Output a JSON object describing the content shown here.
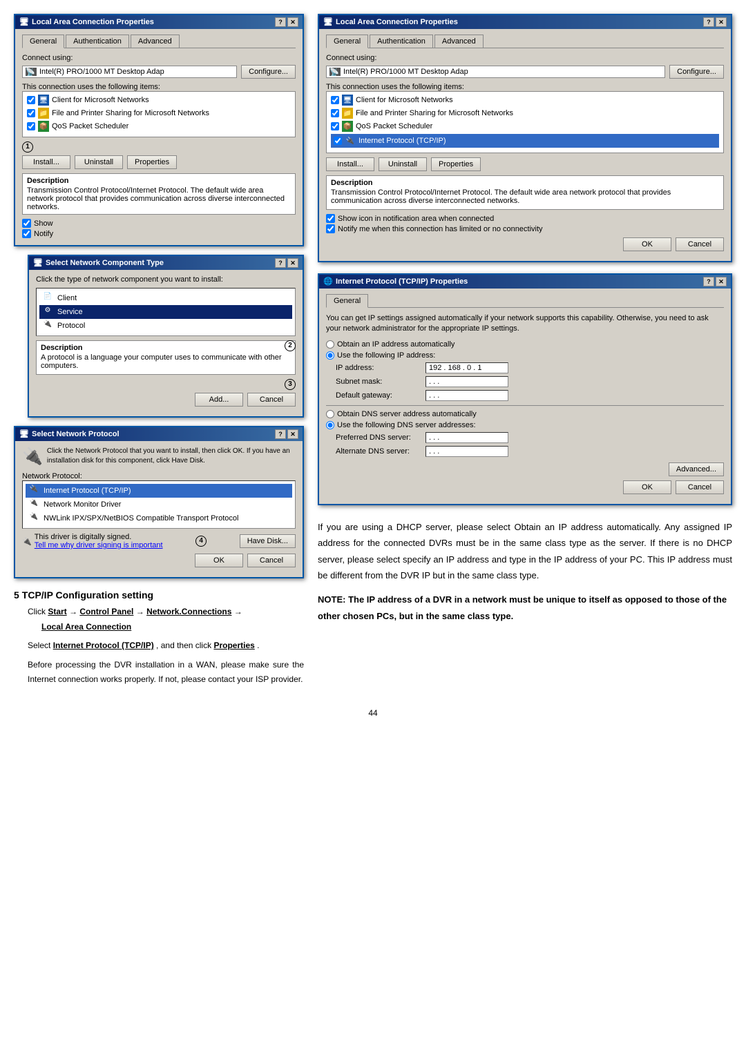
{
  "page": {
    "number": "44"
  },
  "dialog1": {
    "title": "Local Area Connection Properties",
    "tabs": [
      "General",
      "Authentication",
      "Advanced"
    ],
    "active_tab": "General",
    "connect_using_label": "Connect using:",
    "adapter_name": "Intel(R) PRO/1000 MT Desktop Adap",
    "configure_btn": "Configure...",
    "connection_items_label": "This connection uses the following items:",
    "items": [
      {
        "checked": true,
        "icon": "blue",
        "name": "Client for Microsoft Networks"
      },
      {
        "checked": true,
        "icon": "yellow",
        "name": "File and Printer Sharing for Microsoft Networks"
      },
      {
        "checked": true,
        "icon": "green",
        "name": "QoS Packet Scheduler"
      }
    ],
    "install_btn": "Install...",
    "uninstall_btn": "Uninstall",
    "properties_btn": "Properties",
    "desc_label": "Description",
    "desc_text": "Transmission Control Protocol/Internet Protocol. The default wide area network protocol that provides communication across diverse interconnected networks.",
    "show_icon_label": "Show",
    "notify_label": "Notify",
    "number_label": "1"
  },
  "dialog2": {
    "title": "Select Network Component Type",
    "instruction": "Click the type of network component you want to install:",
    "items": [
      {
        "icon": "📄",
        "name": "Client"
      },
      {
        "icon": "⚙",
        "name": "Service",
        "selected": true
      },
      {
        "icon": "🔌",
        "name": "Protocol"
      }
    ],
    "desc_label": "Description",
    "desc_text": "A protocol is a language your computer uses to communicate with other computers.",
    "add_btn": "Add...",
    "cancel_btn": "Cancel",
    "number_label": "2",
    "add_number": "3"
  },
  "dialog3": {
    "title": "Select Network Protocol",
    "instruction": "Click the Network Protocol that you want to install, then click OK. If you have an installation disk for this component, click Have Disk.",
    "network_protocol_label": "Network Protocol:",
    "protocols": [
      {
        "icon": "🔌",
        "name": "Internet Protocol (TCP/IP)",
        "selected": true
      },
      {
        "icon": "🔌",
        "name": "Network Monitor Driver"
      },
      {
        "icon": "🔌",
        "name": "NWLink IPX/SPX/NetBIOS Compatible Transport Protocol"
      }
    ],
    "driver_signed": "This driver is digitally signed.",
    "driver_link": "Tell me why driver signing is important",
    "have_disk_btn": "Have Disk...",
    "ok_btn": "OK",
    "cancel_btn": "Cancel",
    "number_label": "4"
  },
  "dialog4": {
    "title": "Local Area Connection Properties",
    "tabs": [
      "General",
      "Authentication",
      "Advanced"
    ],
    "active_tab": "General",
    "connect_using_label": "Connect using:",
    "adapter_name": "Intel(R) PRO/1000 MT Desktop Adap",
    "configure_btn": "Configure...",
    "connection_items_label": "This connection uses the following items:",
    "items": [
      {
        "checked": true,
        "icon": "blue",
        "name": "Client for Microsoft Networks"
      },
      {
        "checked": true,
        "icon": "yellow",
        "name": "File and Printer Sharing for Microsoft Networks"
      },
      {
        "checked": true,
        "icon": "green",
        "name": "QoS Packet Scheduler"
      },
      {
        "checked": true,
        "icon": "blue",
        "name": "Internet Protocol (TCP/IP)",
        "selected": true
      }
    ],
    "install_btn": "Install...",
    "uninstall_btn": "Uninstall",
    "properties_btn": "Properties",
    "desc_label": "Description",
    "desc_text": "Transmission Control Protocol/Internet Protocol. The default wide area network protocol that provides communication across diverse interconnected networks.",
    "show_icon_label": "Show icon in notification area when connected",
    "notify_label": "Notify me when this connection has limited or no connectivity",
    "ok_btn": "OK",
    "cancel_btn": "Cancel"
  },
  "dialog5": {
    "title": "Internet Protocol (TCP/IP) Properties",
    "tab": "General",
    "intro_text": "You can get IP settings assigned automatically if your network supports this capability. Otherwise, you need to ask your network administrator for the appropriate IP settings.",
    "obtain_auto_label": "Obtain an IP address automatically",
    "use_following_label": "Use the following IP address:",
    "ip_address_label": "IP address:",
    "ip_address_value": "192 . 168 . 0 . 1",
    "subnet_mask_label": "Subnet mask:",
    "subnet_mask_value": ". . .",
    "default_gateway_label": "Default gateway:",
    "default_gateway_value": ". . .",
    "obtain_dns_auto_label": "Obtain DNS server address automatically",
    "use_dns_label": "Use the following DNS server addresses:",
    "preferred_dns_label": "Preferred DNS server:",
    "preferred_dns_value": ". . .",
    "alternate_dns_label": "Alternate DNS server:",
    "alternate_dns_value": ". . .",
    "advanced_btn": "Advanced...",
    "ok_btn": "OK",
    "cancel_btn": "Cancel"
  },
  "step": {
    "number": "5",
    "title": "TCP/IP Configuration setting",
    "instruction1_pre": "Click ",
    "instruction1_bold": "Start",
    "instruction1_arrow": "→",
    "instruction1_bold2": "Control Panel",
    "instruction1_arrow2": "→",
    "instruction1_bold3": "Network.Connections",
    "instruction1_arrow3": "→",
    "instruction1_bold4": "Local Area Connection",
    "instruction2_pre": "Select ",
    "instruction2_bold": "Internet Protocol (TCP/IP)",
    "instruction2_post": ", and then click ",
    "instruction2_bold2": "Properties",
    "instruction2_post2": ".",
    "para1": "Before processing the DVR installation in a WAN, please make sure the Internet connection works properly. If not, please contact your ISP provider.",
    "para2": "If you are using a DHCP server, please select Obtain an IP address automatically. Any assigned IP address for the connected DVRs must be in the same class type as the server. If there is no DHCP server, please select specify an IP address and type in the IP address of your PC. This IP address must be different from the DVR IP but in the same class type.",
    "note_prefix": "NOTE: ",
    "note_bold": "The IP address of a DVR in a network must be unique to itself as opposed to those of the other chosen PCs, but in the same class type."
  }
}
